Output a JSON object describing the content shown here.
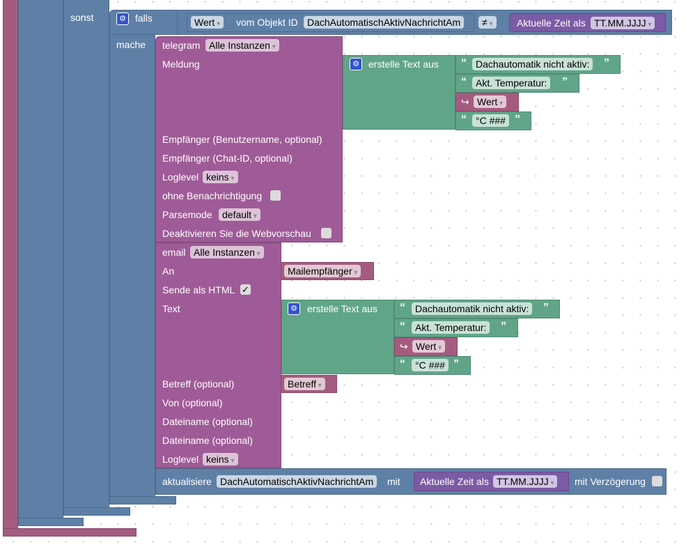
{
  "colors": {
    "logic": "#5f80a6",
    "telegram": "#9f5b97",
    "text": "#61a589",
    "time": "#7b5ba5",
    "variable": "#a55b80"
  },
  "if_block": {
    "else_label": "sonst",
    "if_label": "falls",
    "do_label": "mache"
  },
  "condition": {
    "value_dropdown": "Wert",
    "object_label": "vom Objekt ID",
    "object_id": "DachAutomatischAktivNachrichtAm",
    "operator": "≠",
    "time_label": "Aktuelle Zeit als",
    "time_format": "TT.MM.JJJJ"
  },
  "telegram": {
    "label": "telegram",
    "instance": "Alle Instanzen",
    "message_label": "Meldung",
    "recipient_user": "Empfänger (Benutzername, optional)",
    "recipient_chat": "Empfänger (Chat-ID, optional)",
    "loglevel_label": "Loglevel",
    "loglevel": "keins",
    "silent_label": "ohne Benachrichtigung",
    "parsemode_label": "Parsemode",
    "parsemode": "default",
    "disable_preview_label": "Deaktivieren Sie die Webvorschau"
  },
  "join1": {
    "label": "erstelle Text aus",
    "items": [
      "Dachautomatik nicht aktiv:",
      "Akt. Temperatur:",
      "Wert",
      "°C ###"
    ]
  },
  "email": {
    "label": "email",
    "instance": "Alle Instanzen",
    "to_label": "An",
    "to_var": "Mailempfänger",
    "html_label": "Sende als HTML",
    "html_checked": "✓",
    "text_label": "Text",
    "subject_label": "Betreff (optional)",
    "subject_var": "Betreff",
    "from_label": "Von (optional)",
    "file1_label": "Dateiname (optional)",
    "file2_label": "Dateiname (optional)",
    "loglevel_label": "Loglevel",
    "loglevel": "keins"
  },
  "join2": {
    "label": "erstelle Text aus",
    "items": [
      "Dachautomatik nicht aktiv:",
      "Akt. Temperatur:",
      "Wert",
      "°C ###"
    ]
  },
  "update": {
    "label": "aktualisiere",
    "object_id": "DachAutomatischAktivNachrichtAm",
    "with_label": "mit",
    "time_label": "Aktuelle Zeit als",
    "time_format": "TT.MM.JJJJ",
    "delay_label": "mit Verzögerung"
  }
}
